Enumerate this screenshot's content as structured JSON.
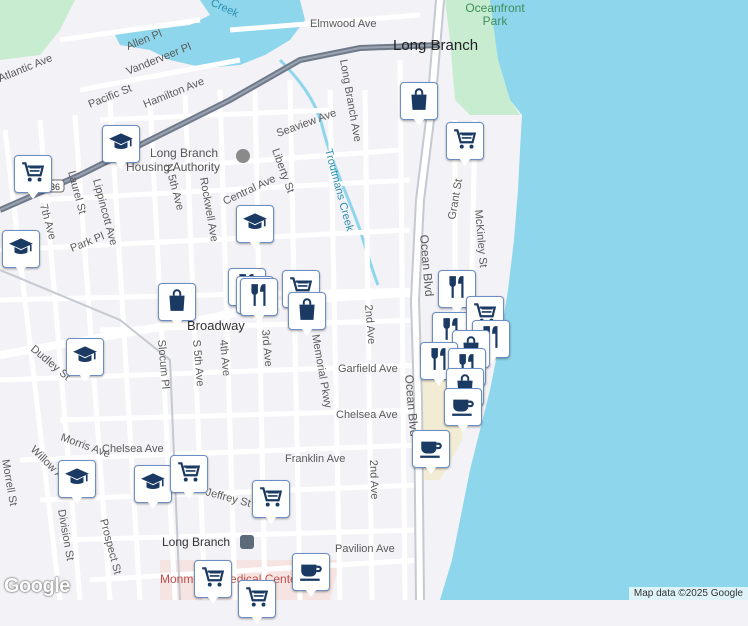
{
  "map": {
    "city_label": "Long Branch",
    "park_label": "Oceanfront Park",
    "station_label": "Long Branch",
    "medical_label": "Monmouth Medical Center",
    "housing_label": "Long Branch Housing Authority",
    "creek_labels": [
      "Troutmans Creek",
      "Creek"
    ],
    "streets": [
      "Elmwood Ave",
      "Allen Pl",
      "Vanderveer Pl",
      "Hamilton Ave",
      "Pacific St",
      "Atlantic Ave",
      "Seaview Ave",
      "Liberty St",
      "Central Ave",
      "Long Branch Ave",
      "Broadway",
      "2nd Ave",
      "3rd Ave",
      "4th Ave",
      "S 5th Ave",
      "N 5th Ave",
      "Rockwell Ave",
      "Laurel St",
      "Lippincott Ave",
      "Park Pl",
      "7th Ave",
      "Slocum Pl",
      "Dudley St",
      "Garfield Ave",
      "Chelsea Ave",
      "Franklin Ave",
      "Morris Ave",
      "Willow Ave",
      "Division St",
      "Prospect St",
      "Pavilion Ave",
      "Ocean Blvd",
      "Grant St",
      "McKinley St",
      "Memorial Pkwy",
      "Morrell St",
      "Jeffrey St"
    ],
    "attribution": "Map data ©2025 Google",
    "logo": "Google",
    "colors": {
      "water": "#8ed6ec",
      "land": "#f3f2f6",
      "road": "#ffffff",
      "highway": "#6f7a8a",
      "park": "#c8ecd0",
      "pin_border": "#6b8ec4",
      "pin_icon": "#1a3a63"
    }
  },
  "pins": [
    {
      "name": "cart-pin",
      "icon": "cart-icon"
    },
    {
      "name": "school-pin",
      "icon": "school-icon"
    },
    {
      "name": "school-pin",
      "icon": "school-icon"
    },
    {
      "name": "school-pin",
      "icon": "school-icon"
    },
    {
      "name": "bag-pin",
      "icon": "bag-icon"
    },
    {
      "name": "cart-pin",
      "icon": "cart-icon"
    },
    {
      "name": "bag-pin",
      "icon": "bag-icon"
    },
    {
      "name": "restaurant-pin",
      "icon": "restaurant-icon"
    },
    {
      "name": "restaurant-pin",
      "icon": "restaurant-icon"
    },
    {
      "name": "cart-pin",
      "icon": "cart-icon"
    },
    {
      "name": "restaurant-pin",
      "icon": "restaurant-icon"
    },
    {
      "name": "bag-pin",
      "icon": "bag-icon"
    },
    {
      "name": "school-pin",
      "icon": "school-icon"
    },
    {
      "name": "restaurant-pin",
      "icon": "restaurant-icon"
    },
    {
      "name": "cart-pin",
      "icon": "cart-icon"
    },
    {
      "name": "restaurant-pin",
      "icon": "restaurant-icon"
    },
    {
      "name": "restaurant-pin",
      "icon": "restaurant-icon"
    },
    {
      "name": "bag-pin",
      "icon": "bag-icon"
    },
    {
      "name": "restaurant-pin",
      "icon": "restaurant-icon"
    },
    {
      "name": "restaurant-pin",
      "icon": "restaurant-icon"
    },
    {
      "name": "bag-pin",
      "icon": "bag-icon"
    },
    {
      "name": "coffee-pin",
      "icon": "coffee-icon"
    },
    {
      "name": "coffee-pin",
      "icon": "coffee-icon"
    },
    {
      "name": "school-pin",
      "icon": "school-icon"
    },
    {
      "name": "school-pin",
      "icon": "school-icon"
    },
    {
      "name": "cart-pin",
      "icon": "cart-icon"
    },
    {
      "name": "cart-pin",
      "icon": "cart-icon"
    },
    {
      "name": "coffee-pin",
      "icon": "coffee-icon"
    },
    {
      "name": "cart-pin",
      "icon": "cart-icon"
    },
    {
      "name": "cart-pin",
      "icon": "cart-icon"
    }
  ]
}
